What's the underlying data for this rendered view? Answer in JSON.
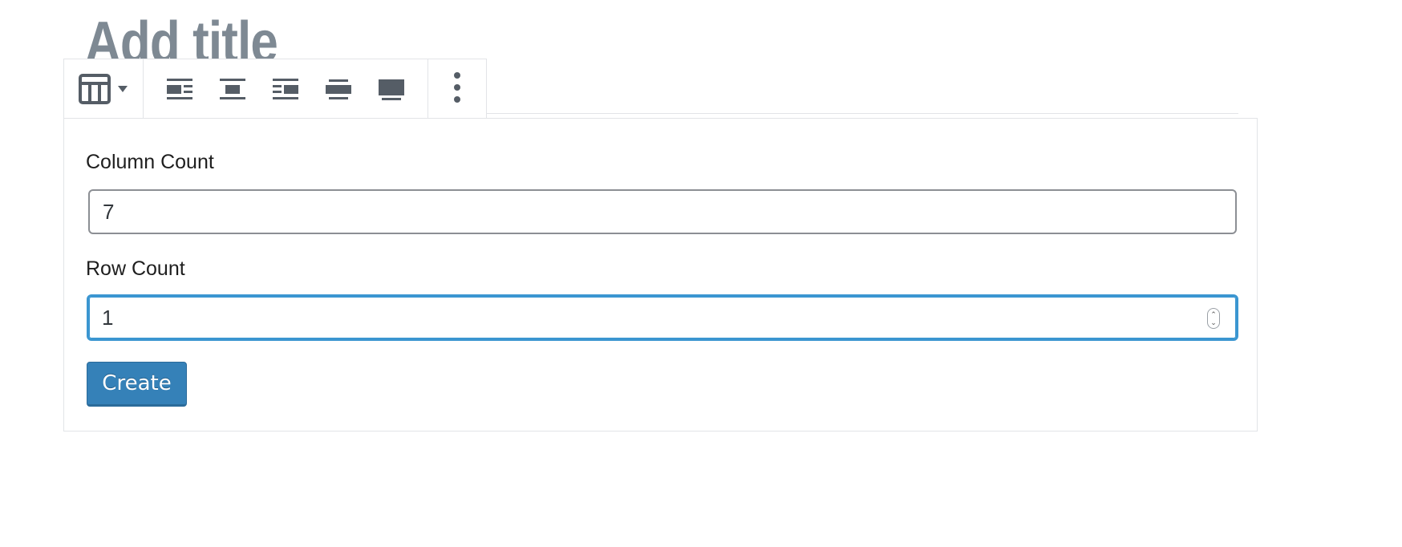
{
  "post": {
    "title_placeholder": "Add title"
  },
  "toolbar": {
    "block_icon": "table-icon",
    "switcher_arrow": "caret-down-icon",
    "align_buttons": [
      {
        "icon": "align-left-icon"
      },
      {
        "icon": "align-center-icon"
      },
      {
        "icon": "align-right-icon"
      },
      {
        "icon": "align-wide-icon"
      },
      {
        "icon": "align-full-icon"
      }
    ],
    "more_icon": "more-vertical-icon"
  },
  "table_placeholder": {
    "column_label": "Column Count",
    "column_value": "7",
    "row_label": "Row Count",
    "row_value": "1",
    "create_label": "Create"
  },
  "colors": {
    "accent": "#3581b8",
    "focus": "#3b96d1",
    "icon": "#555d66",
    "title": "#7e8993"
  }
}
